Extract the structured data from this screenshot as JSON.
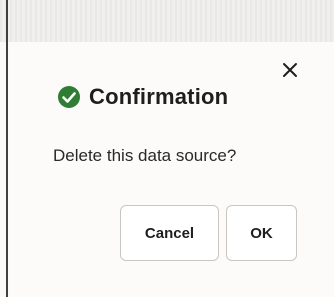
{
  "dialog": {
    "title": "Confirmation",
    "title_icon": "check-circle-icon",
    "message": "Delete this data source?",
    "close_icon": "close-icon",
    "cancel_label": "Cancel",
    "ok_label": "OK",
    "colors": {
      "success": "#2e7d32",
      "text": "#201e1c",
      "button_border": "#c9c6c2"
    }
  }
}
